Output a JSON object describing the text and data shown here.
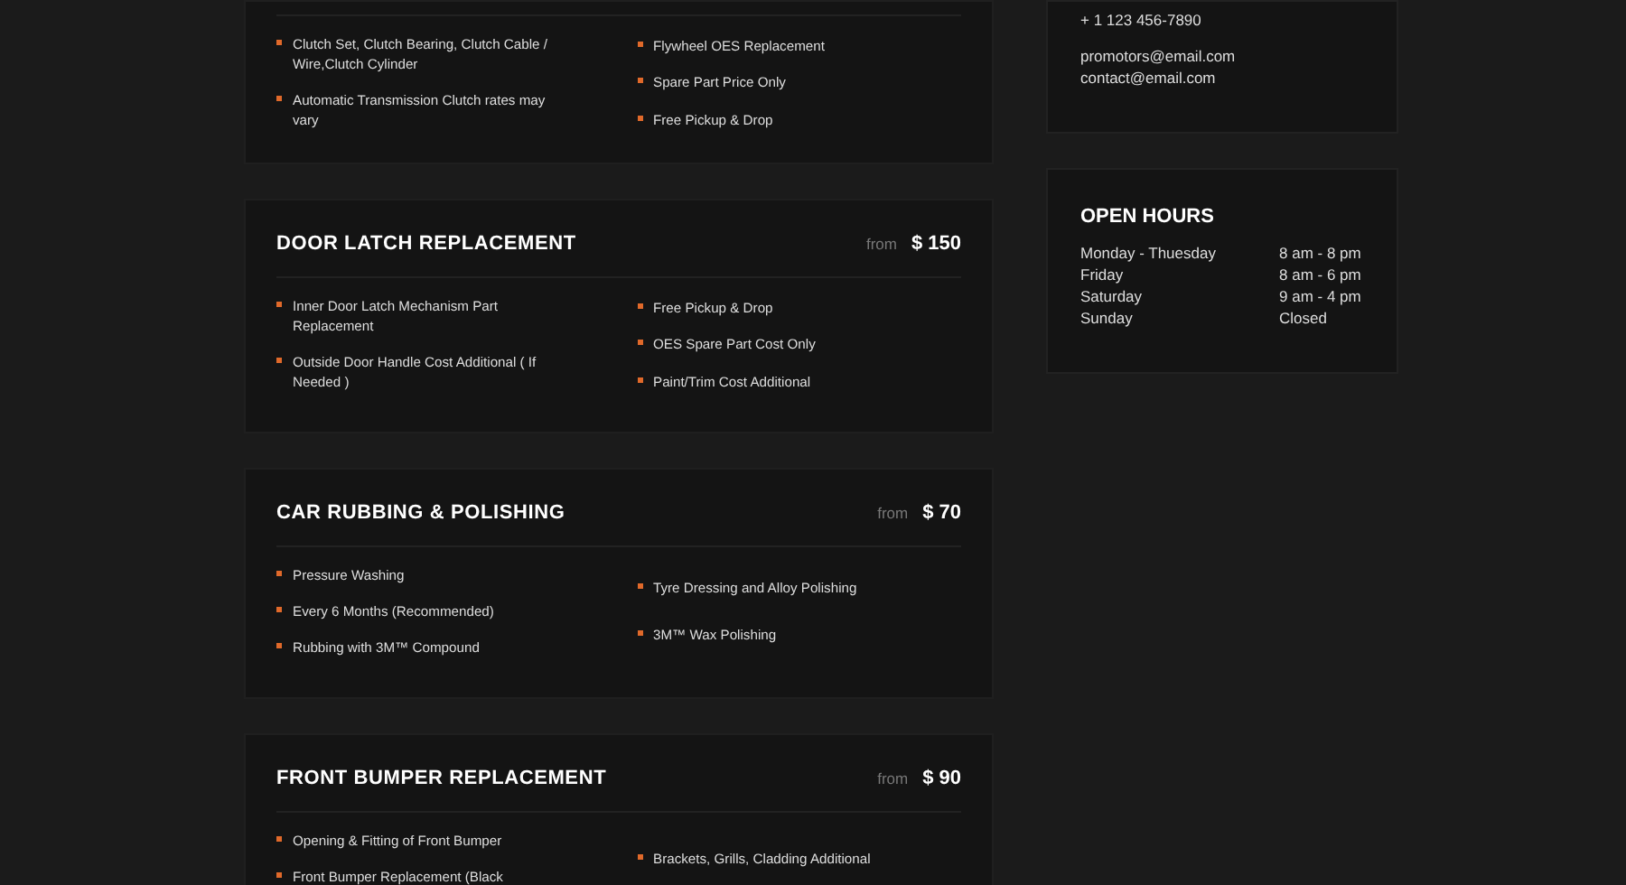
{
  "services": [
    {
      "left": [
        "Clutch Set, Clutch Bearing, Clutch Cable / Wire,Clutch Cylinder",
        "Automatic Transmission Clutch rates may vary"
      ],
      "right": [
        "Flywheel OES Replacement",
        "Spare Part Price Only",
        "Free Pickup & Drop"
      ]
    },
    {
      "title": "DOOR LATCH REPLACEMENT",
      "price_prefix": "from",
      "price": "$ 150",
      "left": [
        "Inner Door Latch Mechanism Part Replacement",
        "Outside Door Handle Cost Additional ( If Needed )"
      ],
      "right": [
        "Free Pickup & Drop",
        "OES Spare Part Cost Only",
        "Paint/Trim Cost Additional"
      ]
    },
    {
      "title": "CAR RUBBING & POLISHING",
      "price_prefix": "from",
      "price": "$ 70",
      "left": [
        "Pressure Washing",
        "Every 6 Months (Recommended)",
        "Rubbing with 3M™ Compound"
      ],
      "right": [
        "Tyre Dressing and Alloy Polishing",
        "3M™ Wax Polishing"
      ]
    },
    {
      "title": "FRONT BUMPER REPLACEMENT",
      "price_prefix": "from",
      "price": "$ 90",
      "left": [
        "Opening & Fitting of Front Bumper",
        "Front Bumper Replacement (Black"
      ],
      "right": [
        "Brackets, Grills, Cladding Additional"
      ]
    }
  ],
  "contact": {
    "phones": [
      "+ 1 123 456-7890"
    ],
    "emails": [
      "promotors@email.com",
      "contact@email.com"
    ]
  },
  "hours": {
    "title": "OPEN HOURS",
    "rows": [
      {
        "day": "Monday - Thuesday",
        "time": "8 am - 8 pm"
      },
      {
        "day": "Friday",
        "time": "8 am - 6 pm"
      },
      {
        "day": "Saturday",
        "time": "9 am - 4 pm"
      },
      {
        "day": "Sunday",
        "time": "Closed"
      }
    ]
  }
}
